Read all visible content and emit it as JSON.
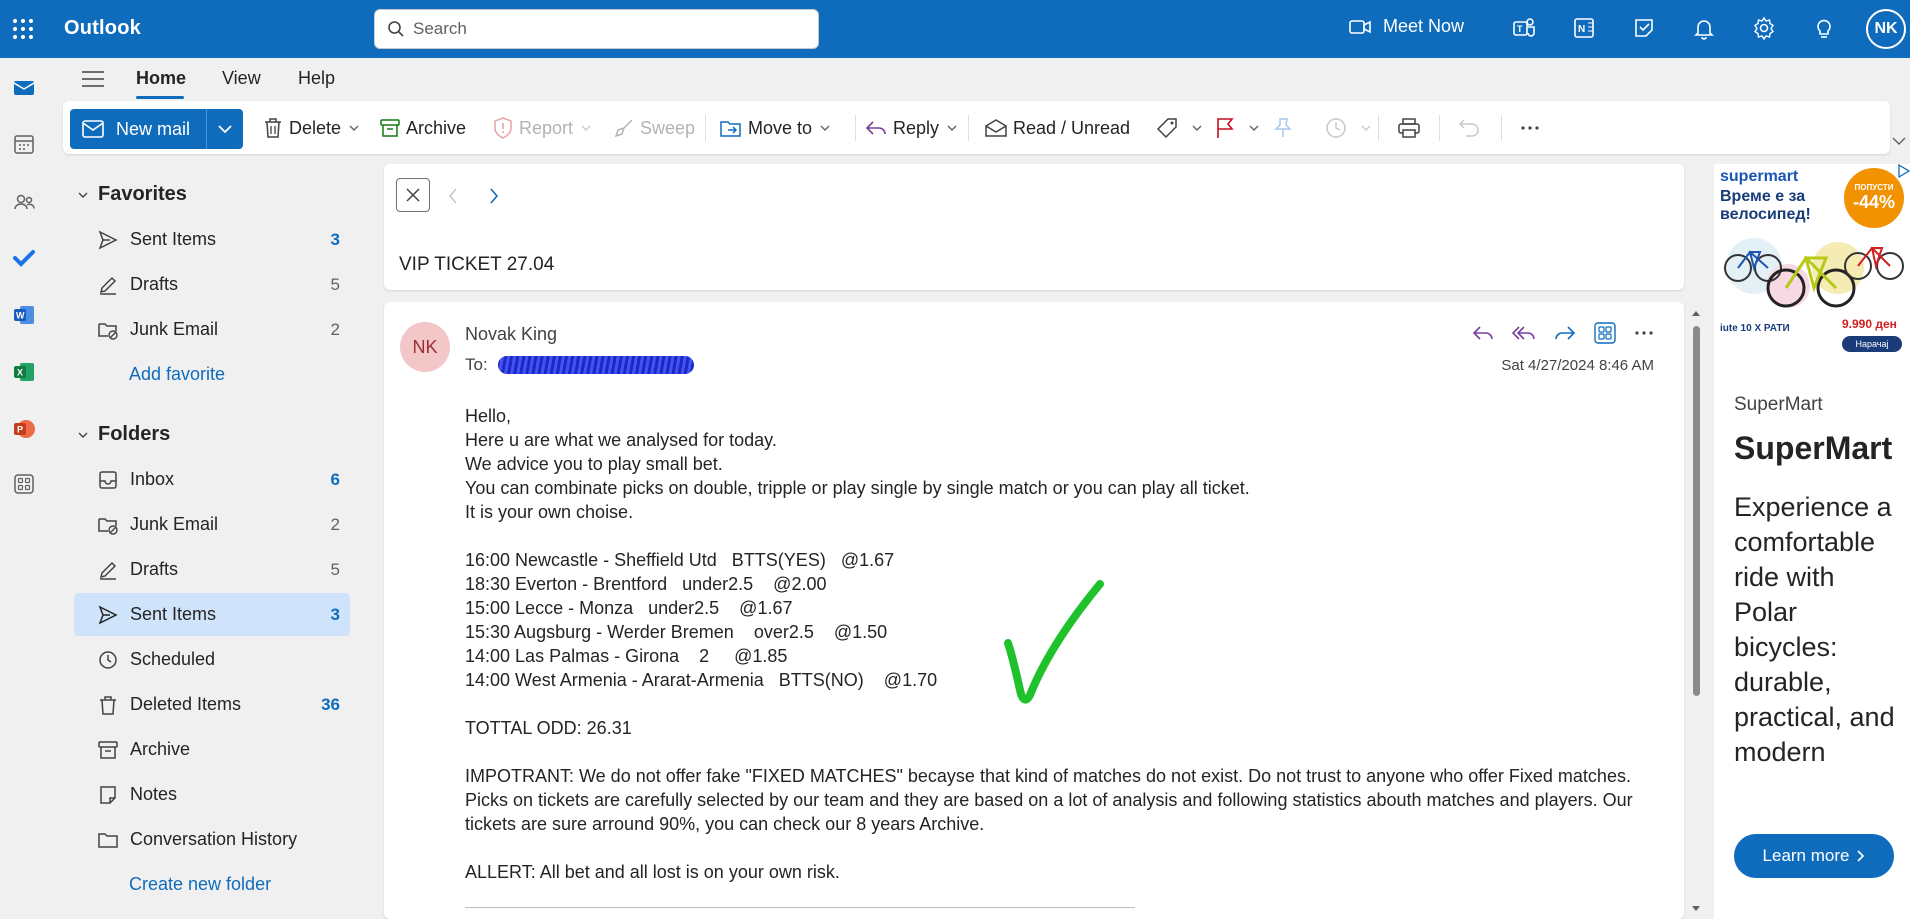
{
  "app": {
    "name": "Outlook"
  },
  "search": {
    "placeholder": "Search"
  },
  "topbar": {
    "meet_now": "Meet Now",
    "avatar_initials": "NK"
  },
  "tabs": [
    {
      "label": "Home"
    },
    {
      "label": "View"
    },
    {
      "label": "Help"
    }
  ],
  "ribbon": {
    "new_mail": "New mail",
    "delete": "Delete",
    "archive": "Archive",
    "report": "Report",
    "sweep": "Sweep",
    "move_to": "Move to",
    "reply": "Reply",
    "read_unread": "Read / Unread"
  },
  "favorites": {
    "heading": "Favorites",
    "items": [
      {
        "label": "Sent Items",
        "count": "3"
      },
      {
        "label": "Drafts",
        "count": "5"
      },
      {
        "label": "Junk Email",
        "count": "2"
      }
    ],
    "add_favorite": "Add favorite"
  },
  "folders": {
    "heading": "Folders",
    "items": [
      {
        "label": "Inbox",
        "count": "6"
      },
      {
        "label": "Junk Email",
        "count": "2"
      },
      {
        "label": "Drafts",
        "count": "5"
      },
      {
        "label": "Sent Items",
        "count": "3"
      },
      {
        "label": "Scheduled",
        "count": ""
      },
      {
        "label": "Deleted Items",
        "count": "36"
      },
      {
        "label": "Archive",
        "count": ""
      },
      {
        "label": "Notes",
        "count": ""
      },
      {
        "label": "Conversation History",
        "count": ""
      }
    ],
    "create_new": "Create new folder"
  },
  "message": {
    "subject": "VIP TICKET 27.04",
    "sender_initials": "NK",
    "sender": "Novak King",
    "to_label": "To:",
    "date": "Sat 4/27/2024 8:46 AM",
    "body": {
      "greeting": "Hello,",
      "l1": "Here u are what we analysed for today.",
      "l2": "We advice you to play small bet.",
      "l3": "You can combinate picks on double, tripple or play single by single match or you can play all ticket.",
      "l4": "It is your own choise.",
      "picks": [
        "16:00 Newcastle - Sheffield Utd   BTTS(YES)   @1.67",
        "18:30 Everton - Brentford   under2.5    @2.00",
        "15:00 Lecce - Monza   under2.5    @1.67",
        "15:30 Augsburg - Werder Bremen    over2.5    @1.50",
        "14:00 Las Palmas - Girona    2     @1.85",
        "14:00 West Armenia - Ararat-Armenia   BTTS(NO)    @1.70"
      ],
      "total": "TOTTAL ODD: 26.31",
      "important": "IMPOTRANT: We do not offer fake \"FIXED MATCHES\" becayse that kind of matches do not exist. Do not trust to anyone who offer Fixed matches. Picks on tickets are carefully selected by our team and they are based on a lot of analysis and following statistics abouth matches and players. Our tickets are sure arround 90%, you can check our 8 years Archive.",
      "allert": "ALLERT: All bet and all lost is on your own risk."
    }
  },
  "ad": {
    "promo_brand": "supermart",
    "promo_headline": "Време е за велосипед!",
    "promo_badge_top": "ПОПУСТИ",
    "promo_badge": "-44%",
    "promo_logo": "iute 10 Х РАТИ",
    "promo_price": "9.990 ден",
    "promo_cta": "Нарачај",
    "brand": "SuperMart",
    "title": "SuperMart",
    "text": "Experience a comfortable ride with Polar bicycles: durable, practical, and modern",
    "cta": "Learn more"
  },
  "colors": {
    "brand_blue": "#0f6cbd",
    "selected_bg": "#cfe4fa",
    "checkmark": "#1fc22a"
  }
}
